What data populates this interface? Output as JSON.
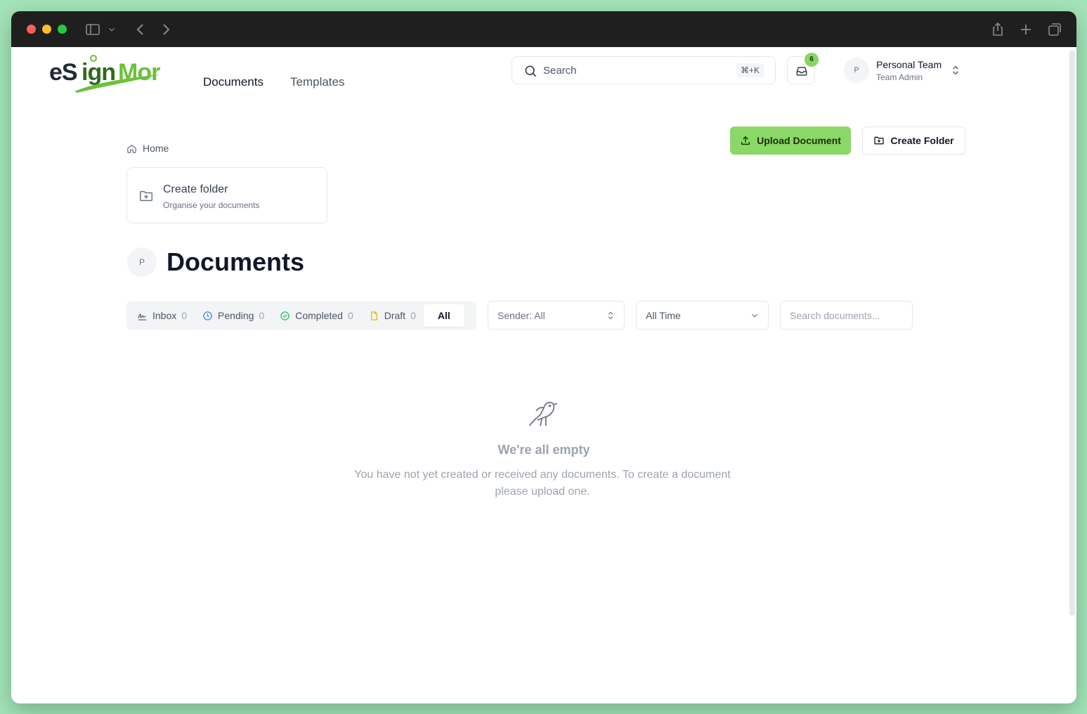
{
  "header": {
    "logo_text": "eSignMor",
    "nav": {
      "documents": "Documents",
      "templates": "Templates"
    },
    "search": {
      "label": "Search",
      "shortcut": "⌘+K"
    },
    "notifications": {
      "count": "6"
    },
    "team": {
      "initial": "P",
      "name": "Personal Team",
      "role": "Team Admin"
    }
  },
  "actions": {
    "upload": "Upload Document",
    "create_folder": "Create Folder"
  },
  "breadcrumb": {
    "home": "Home"
  },
  "folder_card": {
    "title": "Create folder",
    "subtitle": "Organise your documents"
  },
  "page": {
    "avatar": "P",
    "title": "Documents"
  },
  "tabs": [
    {
      "label": "Inbox",
      "count": "0"
    },
    {
      "label": "Pending",
      "count": "0"
    },
    {
      "label": "Completed",
      "count": "0"
    },
    {
      "label": "Draft",
      "count": "0"
    },
    {
      "label": "All"
    }
  ],
  "filters": {
    "sender": "Sender: All",
    "time": "All Time",
    "search_placeholder": "Search documents..."
  },
  "empty_state": {
    "title": "We're all empty",
    "message": "You have not yet created or received any documents. To create a document please upload one."
  },
  "colors": {
    "accent": "#8ad867",
    "desktop": "#a3e4b9"
  }
}
